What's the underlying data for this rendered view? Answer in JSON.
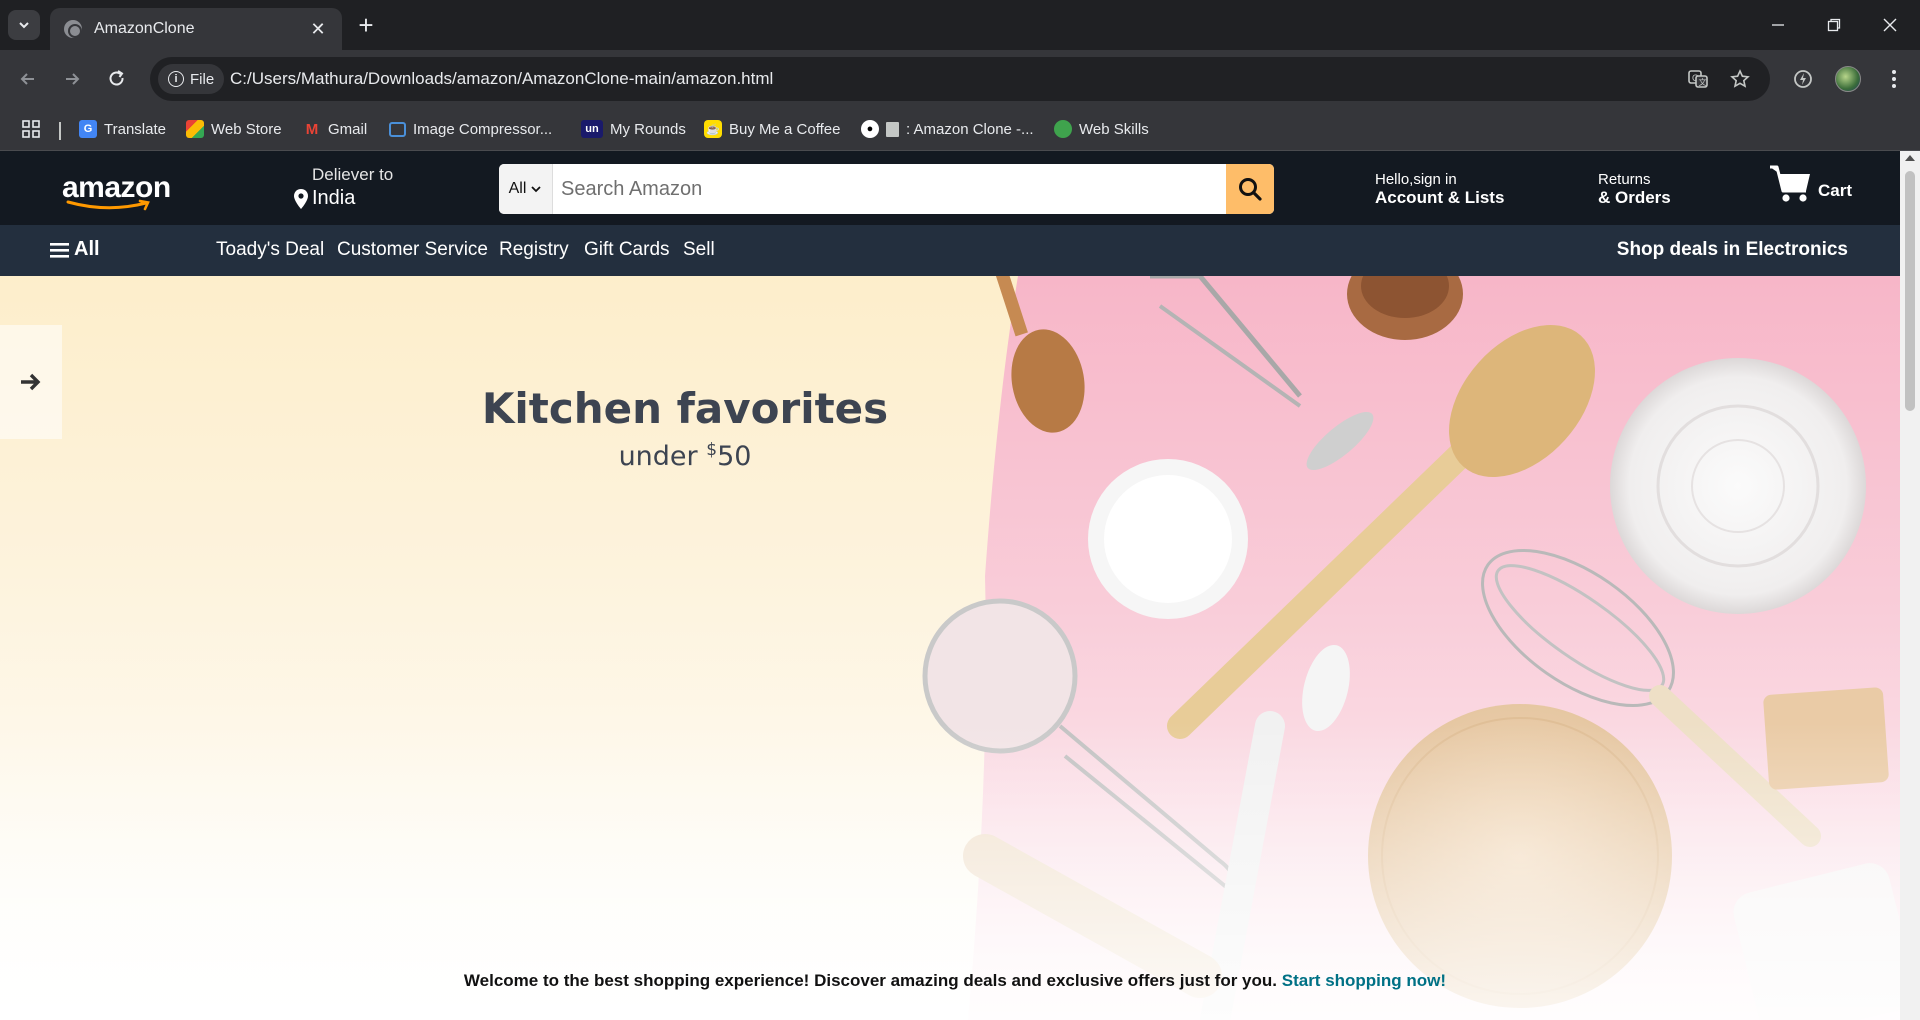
{
  "browser": {
    "tab_title": "AmazonClone",
    "url": "C:/Users/Mathura/Downloads/amazon/AmazonClone-main/amazon.html",
    "site_chip_label": "File",
    "bookmarks": [
      {
        "label": "Translate",
        "icon": "translate-icon",
        "color": "#4285f4"
      },
      {
        "label": "Web Store",
        "icon": "web-store-icon",
        "color": "#e94335"
      },
      {
        "label": "Gmail",
        "icon": "gmail-icon",
        "color": "#ea4335"
      },
      {
        "label": "Image Compressor...",
        "icon": "image-compressor-icon",
        "color": "#4a90d9"
      },
      {
        "label": "My Rounds",
        "icon": "my-rounds-icon",
        "color": "#1a1a6b"
      },
      {
        "label": "Buy Me a Coffee",
        "icon": "coffee-icon",
        "color": "#ffdd00"
      },
      {
        "label": ": Amazon Clone -...",
        "icon": "github-icon",
        "color": "#ffffff"
      },
      {
        "label": "Web Skills",
        "icon": "web-skills-icon",
        "color": "#3fa34d"
      }
    ]
  },
  "header": {
    "logo_text": "amazon",
    "deliver_line1": "Deliever to",
    "deliver_line2": "India",
    "search_category": "All",
    "search_placeholder": "Search Amazon",
    "account_small": "Hello,sign in",
    "account_big": "Account & Lists",
    "returns_small": "Returns",
    "returns_big": "& Orders",
    "cart_label": "Cart"
  },
  "nav": {
    "all_label": "All",
    "links": [
      "Toady's Deal",
      "Customer Service",
      "Registry",
      "Gift Cards",
      "Sell"
    ],
    "promo": "Shop deals in Electronics"
  },
  "hero": {
    "title": "Kitchen favorites",
    "sub_prefix": "under ",
    "sub_currency": "$",
    "sub_amount": "50"
  },
  "welcome": {
    "text": "Welcome to the best shopping experience! Discover amazing deals and exclusive offers just for you.",
    "cta": "Start shopping now!"
  },
  "colors": {
    "amazon_header": "#131921",
    "amazon_nav": "#232f3e",
    "search_button": "#febd69",
    "cta_link": "#007185"
  }
}
